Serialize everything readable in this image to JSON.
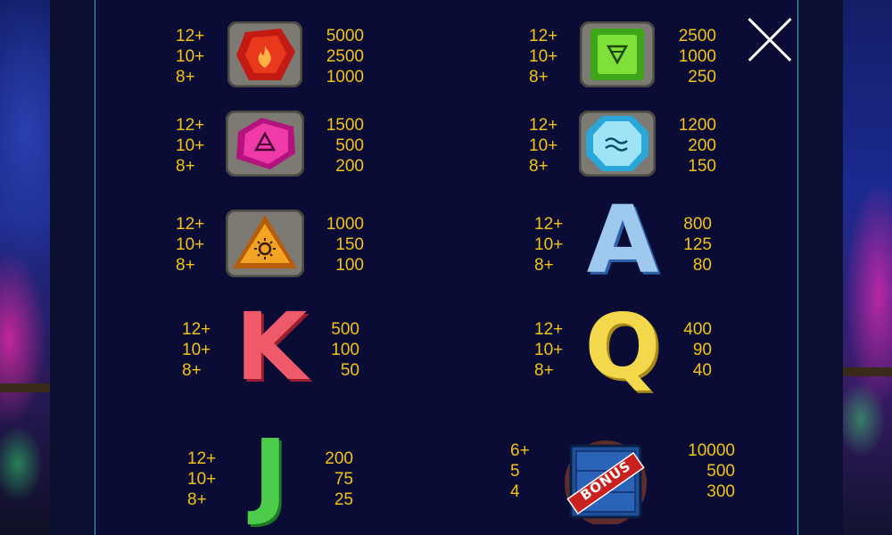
{
  "close_label": "close",
  "paytable": [
    {
      "id": "red-gem",
      "symbol_icon": "red-fire-gem-icon",
      "multipliers": [
        "12+",
        "10+",
        "8+"
      ],
      "payouts": [
        "5000",
        "2500",
        "1000"
      ]
    },
    {
      "id": "green-gem",
      "symbol_icon": "green-earth-gem-icon",
      "multipliers": [
        "12+",
        "10+",
        "8+"
      ],
      "payouts": [
        "2500",
        "1000",
        "250"
      ]
    },
    {
      "id": "pink-gem",
      "symbol_icon": "pink-air-gem-icon",
      "multipliers": [
        "12+",
        "10+",
        "8+"
      ],
      "payouts": [
        "1500",
        "500",
        "200"
      ]
    },
    {
      "id": "blue-gem",
      "symbol_icon": "blue-water-gem-icon",
      "multipliers": [
        "12+",
        "10+",
        "8+"
      ],
      "payouts": [
        "1200",
        "200",
        "150"
      ]
    },
    {
      "id": "orange-gem",
      "symbol_icon": "orange-sun-gem-icon",
      "multipliers": [
        "12+",
        "10+",
        "8+"
      ],
      "payouts": [
        "1000",
        "150",
        "100"
      ]
    },
    {
      "id": "letter-a",
      "symbol_icon": "ice-letter-a-icon",
      "letter": "A",
      "multipliers": [
        "12+",
        "10+",
        "8+"
      ],
      "payouts": [
        "800",
        "125",
        "80"
      ]
    },
    {
      "id": "letter-k",
      "symbol_icon": "red-letter-k-icon",
      "letter": "K",
      "multipliers": [
        "12+",
        "10+",
        "8+"
      ],
      "payouts": [
        "500",
        "100",
        "50"
      ]
    },
    {
      "id": "letter-q",
      "symbol_icon": "gold-letter-q-icon",
      "letter": "Q",
      "multipliers": [
        "12+",
        "10+",
        "8+"
      ],
      "payouts": [
        "400",
        "90",
        "40"
      ]
    },
    {
      "id": "letter-j",
      "symbol_icon": "green-letter-j-icon",
      "letter": "J",
      "multipliers": [
        "12+",
        "10+",
        "8+"
      ],
      "payouts": [
        "200",
        "75",
        "25"
      ]
    },
    {
      "id": "bonus",
      "symbol_icon": "bonus-crate-icon",
      "bonus_label": "BONUS",
      "multipliers": [
        "6+",
        "5",
        "4"
      ],
      "payouts": [
        "10000",
        "500",
        "300"
      ]
    }
  ],
  "colors": {
    "payout_text": "#f2c318",
    "panel_bg": "#0a0c35",
    "border": "#1fb8c9"
  }
}
